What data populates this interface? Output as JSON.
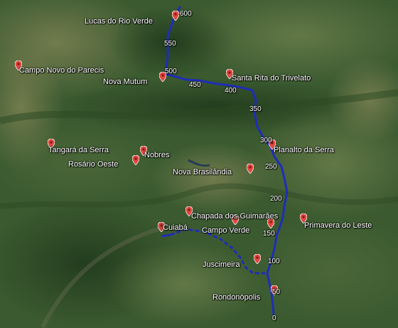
{
  "colors": {
    "route": "#1f2db8",
    "pin": "#e0463e",
    "pin_alt": "#c9453b",
    "label": "#ffffff"
  },
  "places": [
    {
      "key": "lucas",
      "name": "Lucas do Rio Verde"
    },
    {
      "key": "campo-novo",
      "name": "Campo Novo do Parecis"
    },
    {
      "key": "nova-mutum",
      "name": "Nova Mutum"
    },
    {
      "key": "santa-rita",
      "name": "Santa Rita do Trivelato"
    },
    {
      "key": "tangara",
      "name": "Tangará da Serra"
    },
    {
      "key": "nobres",
      "name": "Nobres"
    },
    {
      "key": "rosario",
      "name": "Rosário Oeste"
    },
    {
      "key": "planalto",
      "name": "Planalto da Serra"
    },
    {
      "key": "nova-brasilandia",
      "name": "Nova Brasilândia"
    },
    {
      "key": "chapada",
      "name": "Chapada dos Guimarães"
    },
    {
      "key": "primavera",
      "name": "Primavera do Leste"
    },
    {
      "key": "cuiaba",
      "name": "Cuiabá"
    },
    {
      "key": "campo-verde",
      "name": "Campo Verde"
    },
    {
      "key": "juscimeira",
      "name": "Juscimeira"
    },
    {
      "key": "rondonopolis",
      "name": "Rondonópolis"
    }
  ],
  "km_markers": [
    "600",
    "550",
    "500",
    "450",
    "400",
    "350",
    "300",
    "250",
    "200",
    "150",
    "100",
    "50",
    "0"
  ]
}
